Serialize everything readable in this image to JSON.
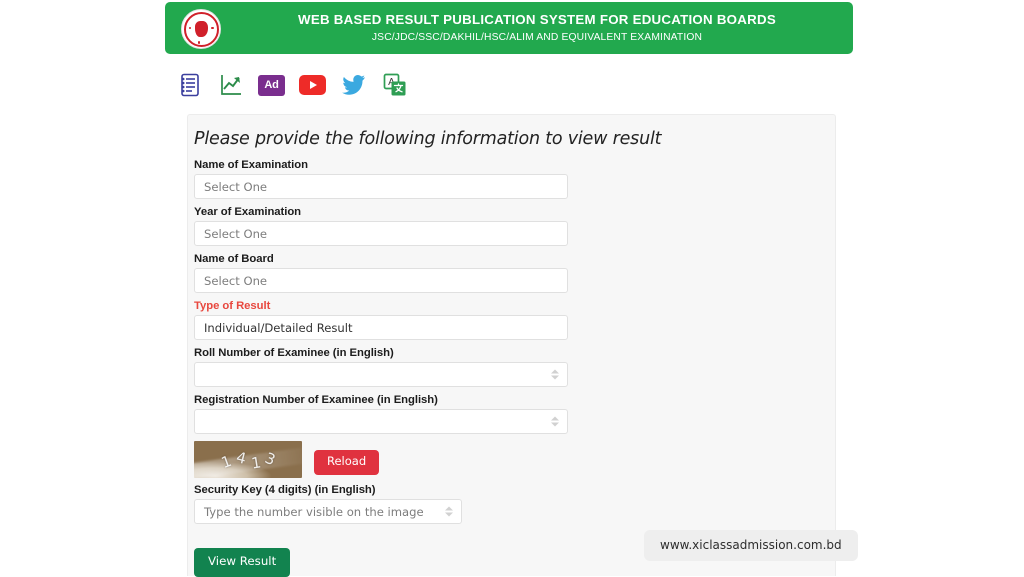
{
  "header": {
    "title": "WEB BASED RESULT PUBLICATION SYSTEM FOR EDUCATION BOARDS",
    "subtitle": "JSC/JDC/SSC/DAKHIL/HSC/ALIM AND EQUIVALENT EXAMINATION",
    "emblem_name": "bangladesh-government-emblem",
    "background_color": "#22a94e",
    "text_color": "#ffffff"
  },
  "toolbar": {
    "icons": [
      {
        "name": "notes-list-icon",
        "label": ""
      },
      {
        "name": "trending-chart-icon",
        "label": ""
      },
      {
        "name": "ad-badge-icon",
        "label": "Ad"
      },
      {
        "name": "youtube-icon",
        "label": ""
      },
      {
        "name": "twitter-bird-icon",
        "label": ""
      },
      {
        "name": "translate-icon",
        "label": "A"
      }
    ]
  },
  "form": {
    "heading": "Please provide the following information to view result",
    "fields": [
      {
        "label": "Name of Examination",
        "value": "Select One",
        "type": "select",
        "filled": false,
        "label_color": "#1c1c1c"
      },
      {
        "label": "Year of Examination",
        "value": "Select One",
        "type": "select",
        "filled": false,
        "label_color": "#1c1c1c"
      },
      {
        "label": "Name of Board",
        "value": "Select One",
        "type": "select",
        "filled": false,
        "label_color": "#1c1c1c"
      },
      {
        "label": "Type of Result",
        "value": "Individual/Detailed Result",
        "type": "select",
        "filled": true,
        "label_color": "#e8483f"
      },
      {
        "label": "Roll Number of Examinee (in English)",
        "value": "",
        "type": "number",
        "filled": false,
        "label_color": "#1c1c1c"
      },
      {
        "label": "Registration Number of Examinee (in English)",
        "value": "",
        "type": "number",
        "filled": false,
        "label_color": "#1c1c1c"
      }
    ],
    "captcha": {
      "digits": "1413",
      "reload_label": "Reload",
      "reload_color": "#e0323f"
    },
    "security_key": {
      "label": "Security Key (4 digits) (in English)",
      "placeholder": "Type the number visible on the image",
      "value": ""
    },
    "submit": {
      "label": "View Result",
      "color": "#12834f"
    }
  },
  "watermark": {
    "text": "www.xiclassadmission.com.bd"
  }
}
